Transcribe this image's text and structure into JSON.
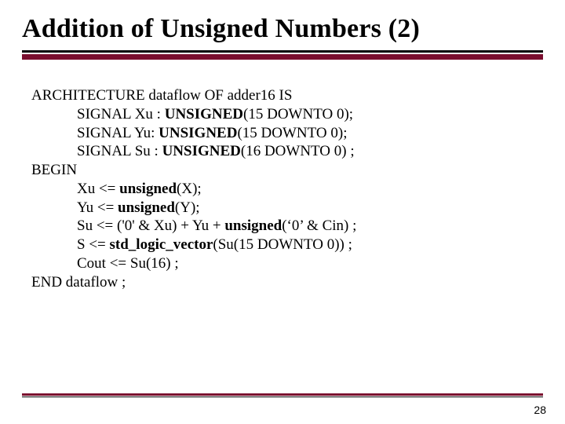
{
  "title": "Addition of Unsigned Numbers (2)",
  "code": {
    "l0": "ARCHITECTURE dataflow OF adder16 IS",
    "l1a": "SIGNAL Xu : ",
    "l1b": "UNSIGNED",
    "l1c": "(15 DOWNTO 0);",
    "l2a": "SIGNAL Yu: ",
    "l2b": "UNSIGNED",
    "l2c": "(15 DOWNTO 0);",
    "l3a": "SIGNAL Su : ",
    "l3b": "UNSIGNED",
    "l3c": "(16 DOWNTO 0) ;",
    "l4": "BEGIN",
    "l5a": "Xu <= ",
    "l5b": "unsigned",
    "l5c": "(X);",
    "l6a": "Yu <= ",
    "l6b": "unsigned",
    "l6c": "(Y);",
    "l7a": "Su <= ('0' & Xu) + Yu + ",
    "l7b": "unsigned",
    "l7c": "(‘0’ & Cin) ;",
    "l8a": "S <= ",
    "l8b": "std_logic_vector",
    "l8c": "(Su(15 DOWNTO 0)) ;",
    "l9": "Cout <= Su(16) ;",
    "l10": "END dataflow ;"
  },
  "page_number": "28"
}
